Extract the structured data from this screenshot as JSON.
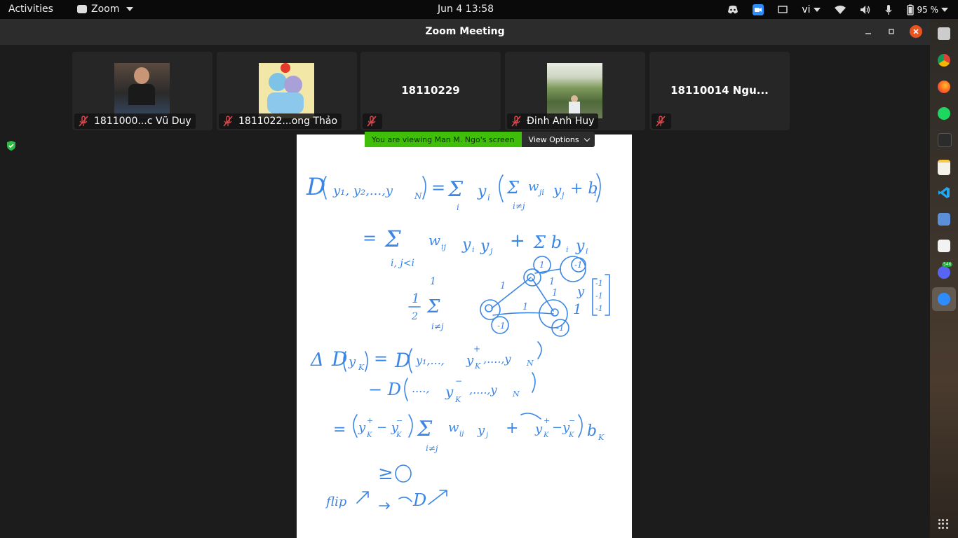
{
  "topbar": {
    "activities": "Activities",
    "app_name": "Zoom",
    "clock": "Jun 4  13:58",
    "input_lang": "vi",
    "battery": "95 %"
  },
  "window": {
    "title": "Zoom Meeting"
  },
  "participants": [
    {
      "label": "1811000...c Vũ Duy",
      "big_name": ""
    },
    {
      "label": "1811022...ong Thảo",
      "big_name": ""
    },
    {
      "label": "",
      "big_name": "18110229"
    },
    {
      "label": "Đinh Anh Huy",
      "big_name": ""
    },
    {
      "label": "",
      "big_name": "18110014 Ngu..."
    }
  ],
  "share": {
    "banner": "You are viewing Man M. Ngo's screen",
    "view_options": "View Options"
  },
  "dock": {
    "discord_badge": "546"
  },
  "colors": {
    "banner_green": "#3fbf0a",
    "ink_blue": "#3a86e6",
    "close_orange": "#e95420"
  }
}
